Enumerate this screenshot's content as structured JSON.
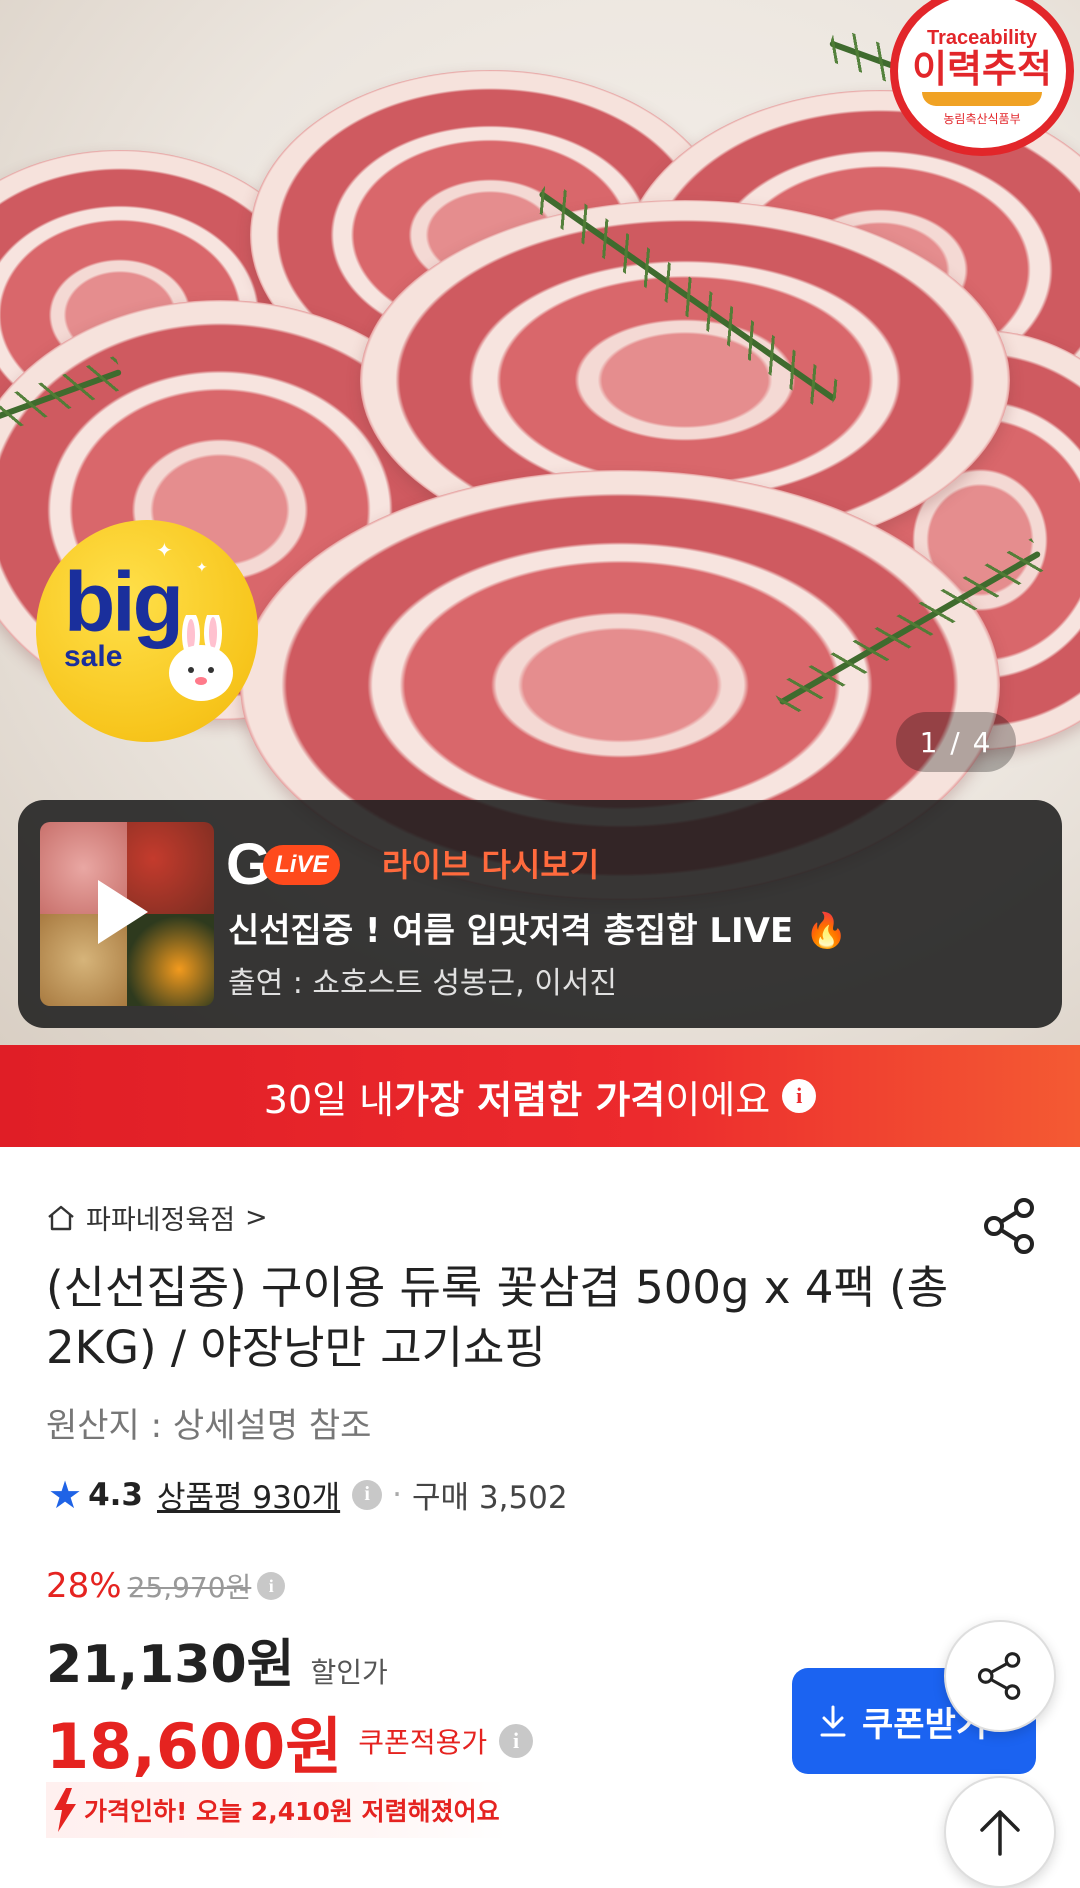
{
  "hero": {
    "traceability": {
      "top": "Traceability",
      "main": "이력추적",
      "sub": "농림축산식품부"
    },
    "badge": {
      "big": "big",
      "sale": "sale"
    },
    "pager": "1 / 4"
  },
  "live": {
    "logo_g": "G",
    "logo_live": "LiVE",
    "replay_label": "라이브 다시보기",
    "title": "신선집중 ! 여름 입맛저격 총집합 LIVE",
    "flame": "🔥",
    "cast": "출연 : 쇼호스트 성봉근, 이서진"
  },
  "banner": {
    "prefix": "30일 내 ",
    "highlight": "가장 저렴한 가격",
    "suffix": "이에요",
    "info": "i"
  },
  "product": {
    "shop_name": "파파네정육점",
    "shop_chevron": ">",
    "title": "(신선집중) 구이용 듀록 꽃삼겹 500g x 4팩 (총 2KG) / 야장낭만 고기쇼핑",
    "origin": "원산지 : 상세설명 참조",
    "rating": "4.3",
    "reviews": "상품평 930개",
    "purchases": "구매 3,502"
  },
  "price": {
    "discount_pct": "28%",
    "original": "25,970원",
    "sale": "21,130원",
    "sale_label": "할인가",
    "coupon": "18,600원",
    "coupon_label": "쿠폰적용가",
    "drop_text": "가격인하! 오늘 2,410원 저렴해졌어요"
  },
  "actions": {
    "coupon_button": "쿠폰받기"
  },
  "colors": {
    "accent_red": "#e52320",
    "button_blue": "#1b63f1",
    "live_orange": "#ff6a3d"
  }
}
